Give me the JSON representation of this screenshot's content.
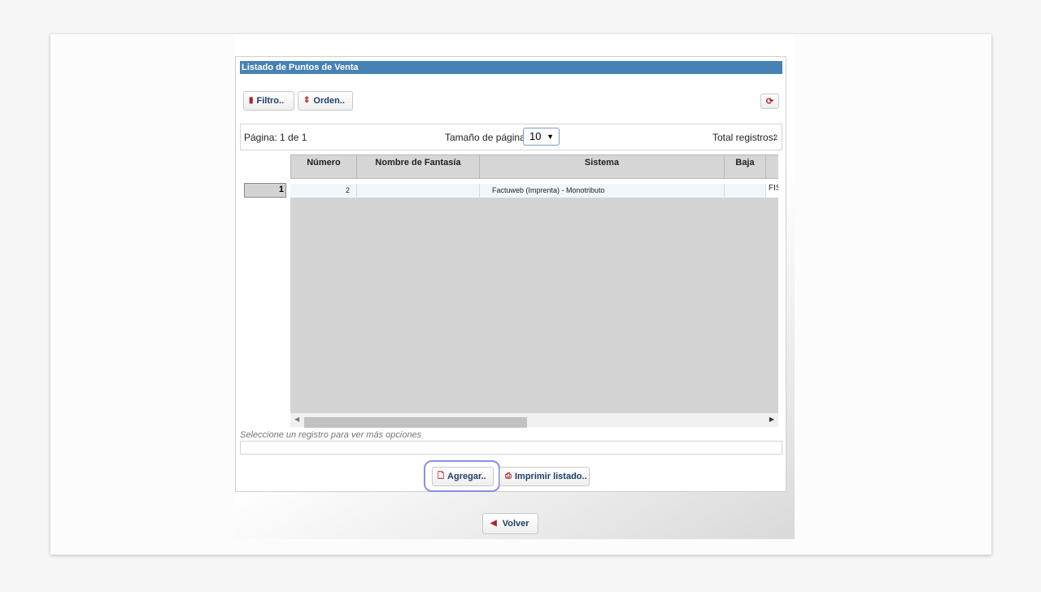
{
  "panel": {
    "title": "Listado de Puntos de Venta"
  },
  "toolbar": {
    "filter_label": "Filtro..",
    "order_label": "Orden.."
  },
  "pager": {
    "page_label": "Página: 1 de 1",
    "page_size_label": "Tamaño de página:",
    "page_size_value": "10",
    "total_label": "Total registros:",
    "total_value": "2"
  },
  "grid": {
    "columns": [
      "Número",
      "Nombre de Fantasía",
      "Sistema",
      "Baja",
      ""
    ],
    "rows": [
      {
        "index": "1",
        "numero": "2",
        "nombre": "",
        "sistema": "Factuweb (Imprenta) - Monotributo",
        "baja": "",
        "extra": "FIS"
      }
    ]
  },
  "hint": "Seleccione un registro para ver más opciones",
  "actions": {
    "add_label": "Agregar..",
    "print_label": "Imprimir listado..",
    "back_label": "Volver"
  }
}
